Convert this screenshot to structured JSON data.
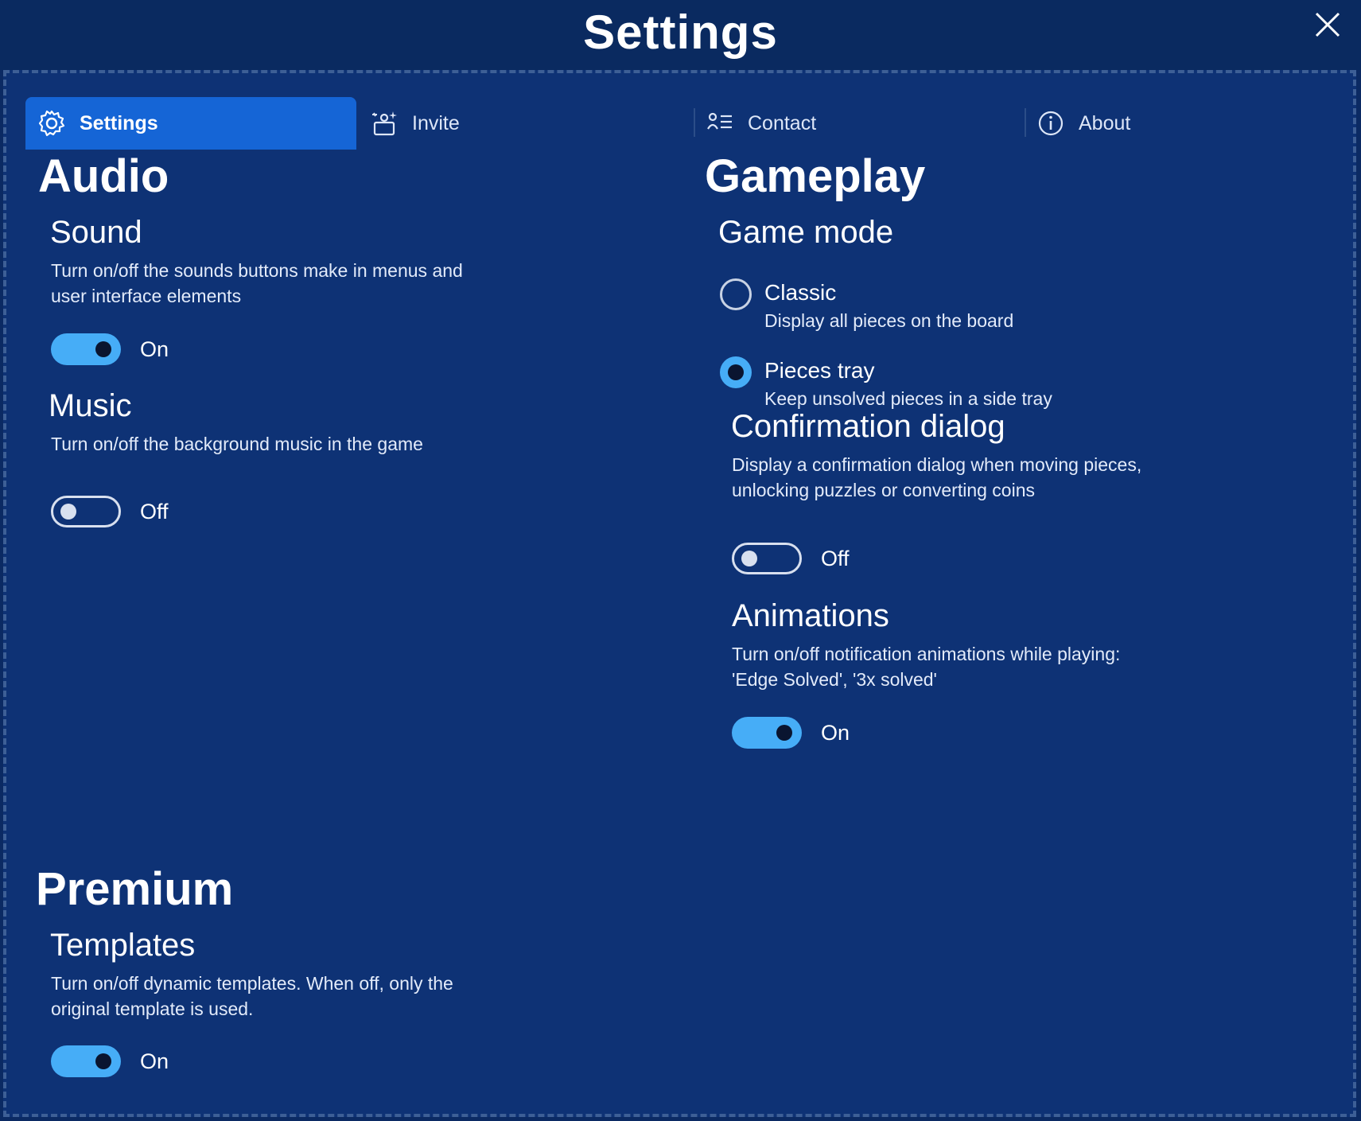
{
  "window": {
    "title": "Settings",
    "close_icon": "close-icon"
  },
  "tabs": [
    {
      "label": "Settings",
      "icon": "gear-icon",
      "active": true
    },
    {
      "label": "Invite",
      "icon": "invite-sparkle-icon",
      "active": false
    },
    {
      "label": "Contact",
      "icon": "contact-list-icon",
      "active": false
    },
    {
      "label": "About",
      "icon": "info-icon",
      "active": false
    }
  ],
  "audio": {
    "title": "Audio",
    "sound": {
      "title": "Sound",
      "desc_line1": "Turn on/off the sounds buttons make in menus and",
      "desc_line2": "user interface elements",
      "state": "On"
    },
    "music": {
      "title": "Music",
      "desc": "Turn on/off the background music in the game",
      "state": "Off"
    }
  },
  "gameplay": {
    "title": "Gameplay",
    "game_mode": {
      "title": "Game mode",
      "options": [
        {
          "label": "Classic",
          "desc": "Display all pieces on the board",
          "selected": false
        },
        {
          "label": "Pieces tray",
          "desc": "Keep unsolved pieces in a side tray",
          "selected": true
        }
      ]
    },
    "confirmation": {
      "title": "Confirmation dialog",
      "desc_line1": "Display a confirmation dialog when moving pieces,",
      "desc_line2": "unlocking puzzles or converting coins",
      "state": "Off"
    },
    "animations": {
      "title": "Animations",
      "desc_line1": "Turn on/off notification animations while playing:",
      "desc_line2": "'Edge Solved', '3x solved'",
      "state": "On"
    }
  },
  "premium": {
    "title": "Premium",
    "templates": {
      "title": "Templates",
      "desc_line1": "Turn on/off dynamic templates. When off, only the",
      "desc_line2": "original template is used.",
      "state": "On"
    }
  },
  "colors": {
    "background": "#0e3275",
    "header": "#0a2a60",
    "active_tab": "#1565d6",
    "toggle_on": "#46adf7"
  }
}
